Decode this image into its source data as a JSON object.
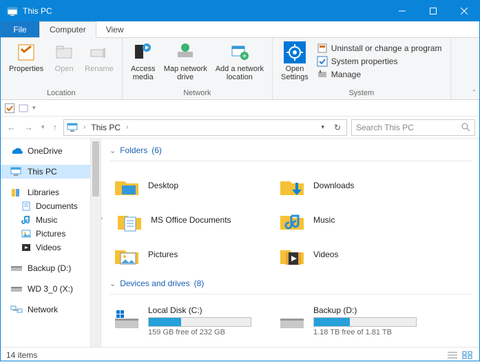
{
  "window": {
    "title": "This PC"
  },
  "tabs": {
    "file": "File",
    "computer": "Computer",
    "view": "View"
  },
  "ribbon": {
    "location": {
      "label": "Location",
      "properties": "Properties",
      "open": "Open",
      "rename": "Rename"
    },
    "network": {
      "label": "Network",
      "access_media": "Access\nmedia",
      "map_drive": "Map network\ndrive",
      "add_loc": "Add a network\nlocation"
    },
    "open_settings": "Open\nSettings",
    "system": {
      "label": "System",
      "uninstall": "Uninstall or change a program",
      "props": "System properties",
      "manage": "Manage"
    }
  },
  "address": {
    "crumb": "This PC",
    "search_placeholder": "Search This PC"
  },
  "sidebar": {
    "onedrive": "OneDrive",
    "thispc": "This PC",
    "libraries": "Libraries",
    "documents": "Documents",
    "music": "Music",
    "pictures": "Pictures",
    "videos": "Videos",
    "backup": "Backup (D:)",
    "wd": "WD 3_0 (X:)",
    "network": "Network"
  },
  "groups": {
    "folders": {
      "label": "Folders",
      "count": "(6)"
    },
    "devices": {
      "label": "Devices and drives",
      "count": "(8)"
    }
  },
  "folders": {
    "desktop": "Desktop",
    "downloads": "Downloads",
    "msoffice": "MS Office Documents",
    "music": "Music",
    "pictures": "Pictures",
    "videos": "Videos"
  },
  "drives": {
    "local": {
      "name": "Local Disk (C:)",
      "free": "159 GB free of 232 GB",
      "pct": 32
    },
    "backup": {
      "name": "Backup (D:)",
      "free": "1.18 TB free of 1.81 TB",
      "pct": 35
    }
  },
  "status": {
    "items": "14 items"
  }
}
